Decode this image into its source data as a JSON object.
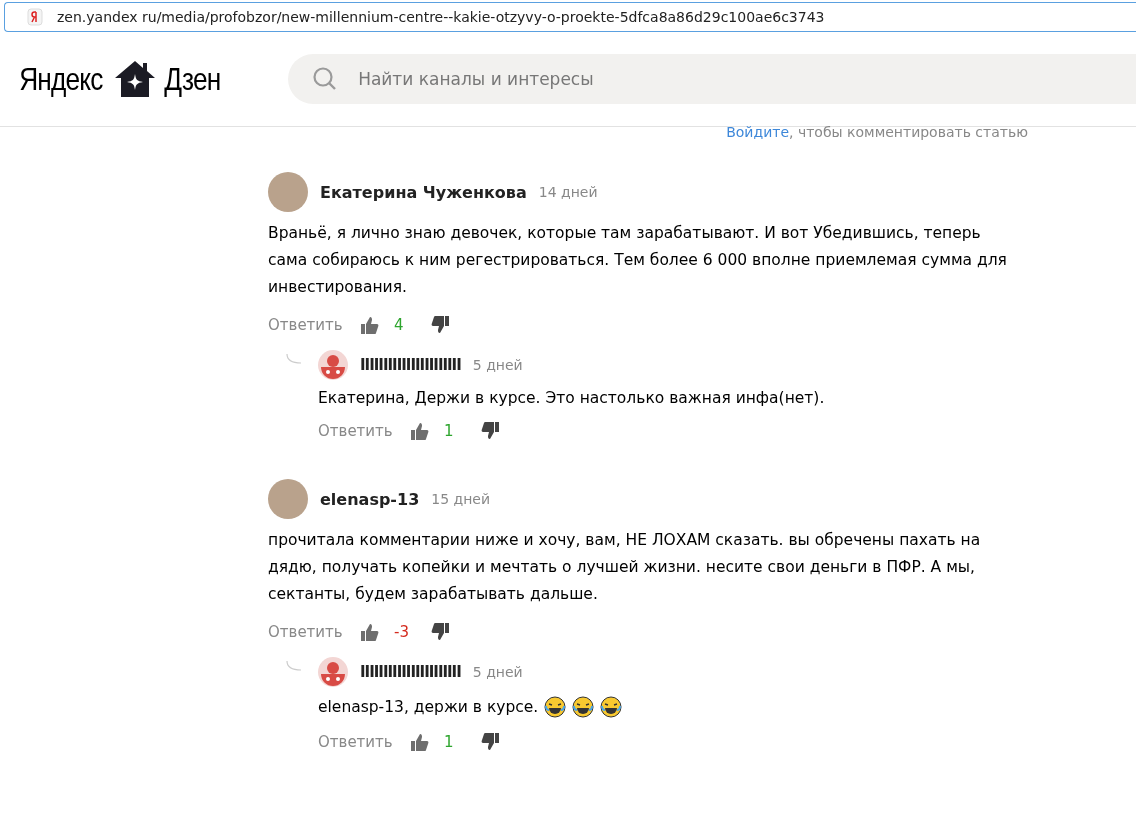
{
  "address_bar": {
    "url": "zen.yandex ru/media/profobzor/new-millennium-centre--kakie-otzyvy-o-proekte-5dfca8a86d29c100ae6c3743"
  },
  "header": {
    "logo_left": "Яндекс",
    "logo_right": "Дзен",
    "search": {
      "placeholder": "Найти каналы и интересы"
    }
  },
  "login_prompt": {
    "link": "Войдите",
    "text": ", чтобы комментировать статью"
  },
  "comments": [
    {
      "author": "Екатерина Чуженкова",
      "time": "14 дней",
      "text": "Враньё, я лично знаю девочек, которые там зарабатывают. И вот Убедившись, теперь сама собираюсь к ним регестрироваться. Тем более 6 000 вполне приемлемая сумма для инвестирования.",
      "reply_label": "Ответить",
      "score": {
        "text": "4",
        "color": "#2ea52e"
      },
      "replies": [
        {
          "author": "IIIIIIIIIIIIIIIIIIIIII",
          "time": "5 дней",
          "text": "Екатерина, Держи в курсе. Это настолько важная инфа(нет).",
          "reply_label": "Ответить",
          "score": {
            "text": "1",
            "color": "#2ea52e"
          }
        }
      ]
    },
    {
      "author": "elenasp-13",
      "time": "15 дней",
      "text": "прочитала комментарии ниже и хочу, вам, НЕ ЛОХАМ сказать. вы обречены пахать на дядю, получать копейки и мечтать о лучшей жизни. несите свои деньги в ПФР. А мы, сектанты, будем зарабатывать дальше.",
      "reply_label": "Ответить",
      "score": {
        "text": "-3",
        "color": "#d42a1e"
      },
      "replies": [
        {
          "author": "IIIIIIIIIIIIIIIIIIIIII",
          "time": "5 дней",
          "text": "elenasp-13, держи в курсе.",
          "emojis": [
            {
              "kind": "laugh"
            },
            {
              "kind": "laugh"
            },
            {
              "kind": "laugh"
            }
          ],
          "reply_label": "Ответить",
          "score": {
            "text": "1",
            "color": "#2ea52e"
          }
        }
      ]
    }
  ]
}
